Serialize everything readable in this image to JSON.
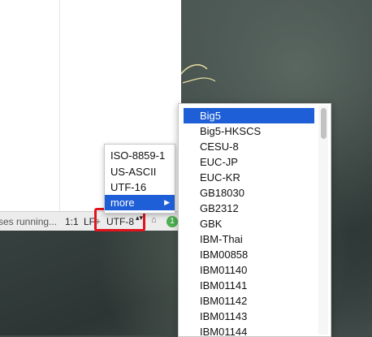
{
  "status_bar": {
    "process_text": "ses running...",
    "position": "1:1",
    "line_ending": "LF÷",
    "encoding": "UTF-8",
    "encoding_arrows": "▴▾",
    "lock_icon": "⌂",
    "notification_count": "1"
  },
  "popup_menu": {
    "items": [
      "ISO-8859-1",
      "US-ASCII",
      "UTF-16",
      "more"
    ],
    "selected": "more",
    "submenu_arrow": "▶"
  },
  "encoding_list": {
    "items": [
      "Big5",
      "Big5-HKSCS",
      "CESU-8",
      "EUC-JP",
      "EUC-KR",
      "GB18030",
      "GB2312",
      "GBK",
      "IBM-Thai",
      "IBM00858",
      "IBM01140",
      "IBM01141",
      "IBM01142",
      "IBM01143",
      "IBM01144"
    ],
    "selected": "Big5"
  },
  "colors": {
    "selection": "#1e5ed6",
    "highlight_box": "#e0141e",
    "badge": "#4caf50"
  }
}
